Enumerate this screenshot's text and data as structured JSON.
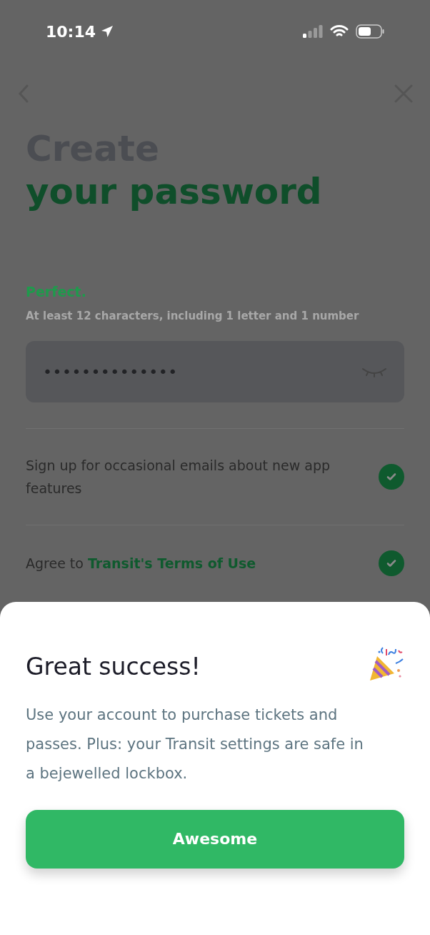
{
  "status_bar": {
    "time": "10:14"
  },
  "title": {
    "line_1": "Create",
    "line_2": "your password"
  },
  "password": {
    "status": "Perfect.",
    "hint": "At least 12 characters, including 1 letter and 1 number",
    "value": "••••••••••••••",
    "revealed": false
  },
  "options": [
    {
      "kind": "plain",
      "text": "Sign up for occasional emails about new app features",
      "checked": true
    },
    {
      "kind": "link",
      "text": "Agree to",
      "link": "Transit's Terms of Use",
      "checked": true
    }
  ],
  "sheet": {
    "title": "Great success!",
    "body": "Use your account to purchase tickets and passes. Plus: your Transit settings are safe in a bejewelled lockbox.",
    "button": "Awesome"
  }
}
